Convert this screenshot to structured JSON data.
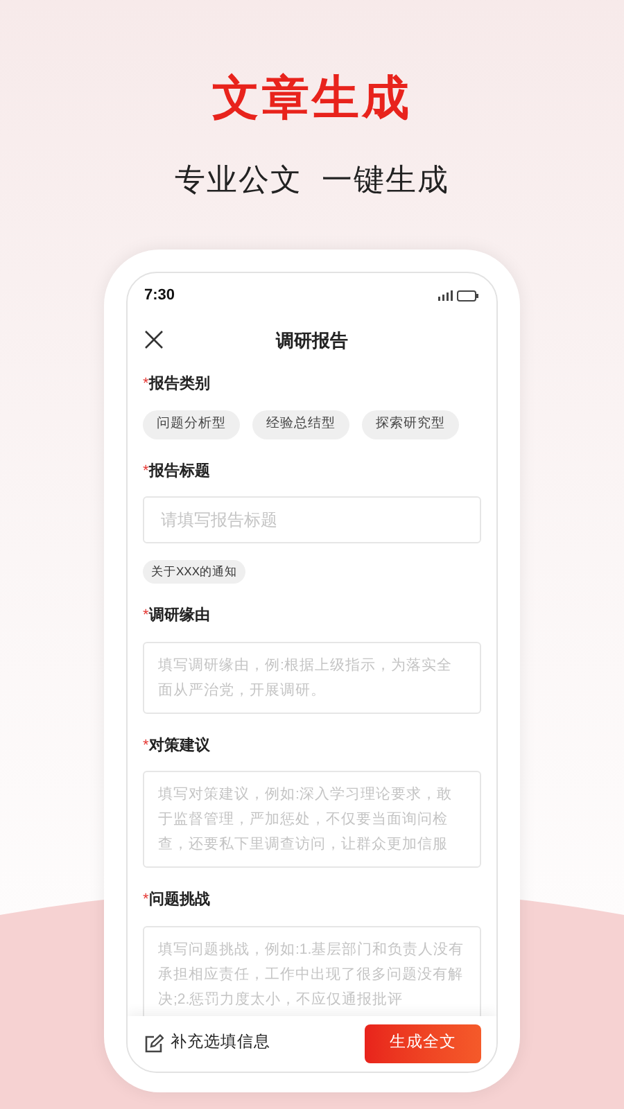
{
  "hero": {
    "title": "文章生成",
    "subtitle": "专业公文  一键生成"
  },
  "status_bar": {
    "time": "7:30"
  },
  "header": {
    "title": "调研报告"
  },
  "fields": [
    {
      "kind": "chips",
      "required_mark": "*",
      "label": "报告类别",
      "options": [
        {
          "label": "问题分析型",
          "selected": false
        },
        {
          "label": "经验总结型",
          "selected": false
        },
        {
          "label": "探索研究型",
          "selected": false
        }
      ]
    },
    {
      "kind": "input",
      "required_mark": "*",
      "label": "报告标题",
      "placeholder": "请填写报告标题",
      "suggestions": [
        "关于XXX的通知"
      ]
    },
    {
      "kind": "textarea",
      "required_mark": "*",
      "label": "调研缘由",
      "placeholder": "填写调研缘由，例:根据上级指示，为落实全面从严治党，开展调研。"
    },
    {
      "kind": "textarea",
      "required_mark": "*",
      "label": "对策建议",
      "placeholder": "填写对策建议，例如:深入学习理论要求，敢于监督管理，严加惩处，不仅要当面询问检查，还要私下里调查访问，让群众更加信服"
    },
    {
      "kind": "textarea",
      "required_mark": "*",
      "label": "问题挑战",
      "placeholder": "填写问题挑战，例如:1.基层部门和负责人没有承担相应责任，工作中出现了很多问题没有解决;2.惩罚力度太小，不应仅通报批评"
    }
  ],
  "bottom_bar": {
    "extra_label": "补充选填信息",
    "generate_button": "生成全文"
  }
}
